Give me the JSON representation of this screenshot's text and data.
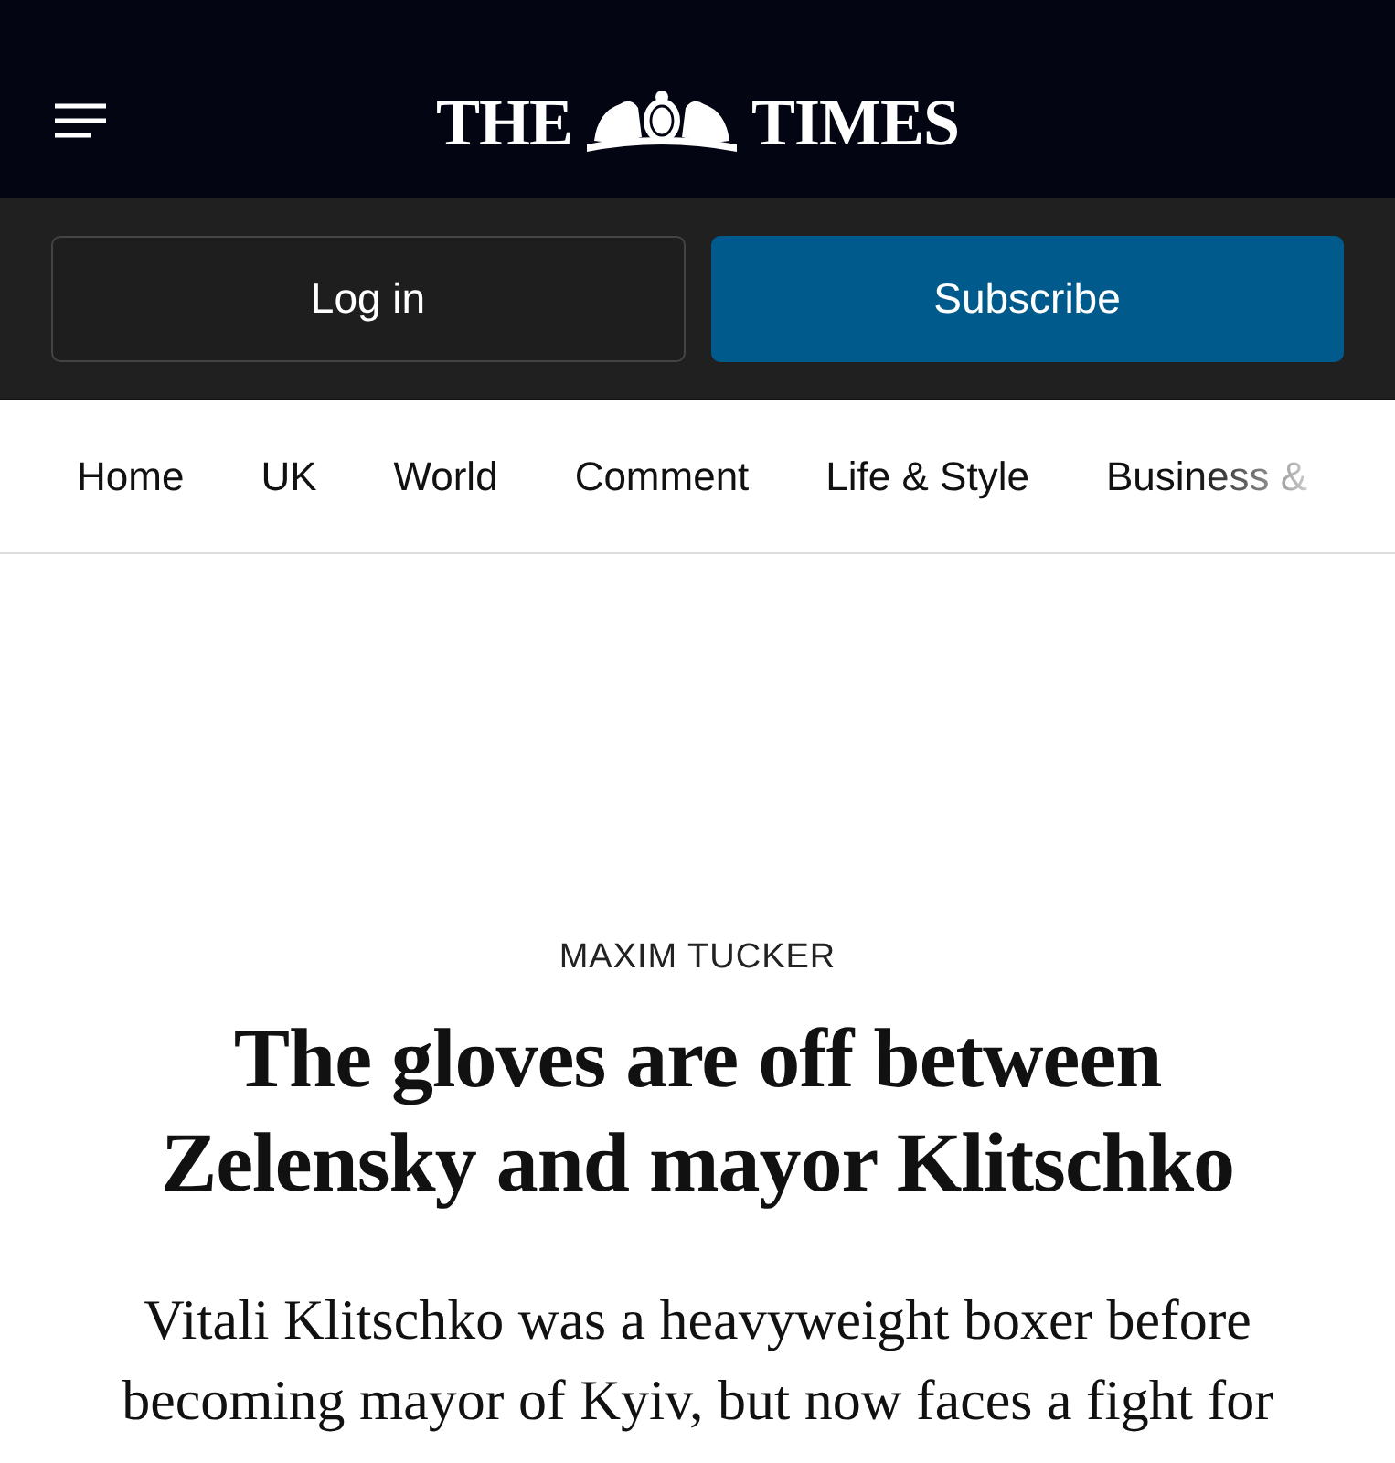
{
  "header": {
    "logo": {
      "left": "THE",
      "right": "TIMES"
    }
  },
  "account_buttons": [
    {
      "label": "Log in",
      "kind": "secondary"
    },
    {
      "label": "Subscribe",
      "kind": "primary"
    }
  ],
  "nav": {
    "items": [
      {
        "label": "Home",
        "faded": false
      },
      {
        "label": "UK",
        "faded": false
      },
      {
        "label": "World",
        "faded": false
      },
      {
        "label": "Comment",
        "faded": false
      },
      {
        "label": "Life & Style",
        "faded": false
      },
      {
        "label": "Business &",
        "faded": true
      }
    ]
  },
  "article": {
    "byline": "MAXIM TUCKER",
    "headline": "The gloves are off between Zelensky and mayor Klitschko",
    "standfirst": "Vitali Klitschko was a heavyweight boxer before becoming mayor of Kyiv, but now faces a fight for"
  }
}
